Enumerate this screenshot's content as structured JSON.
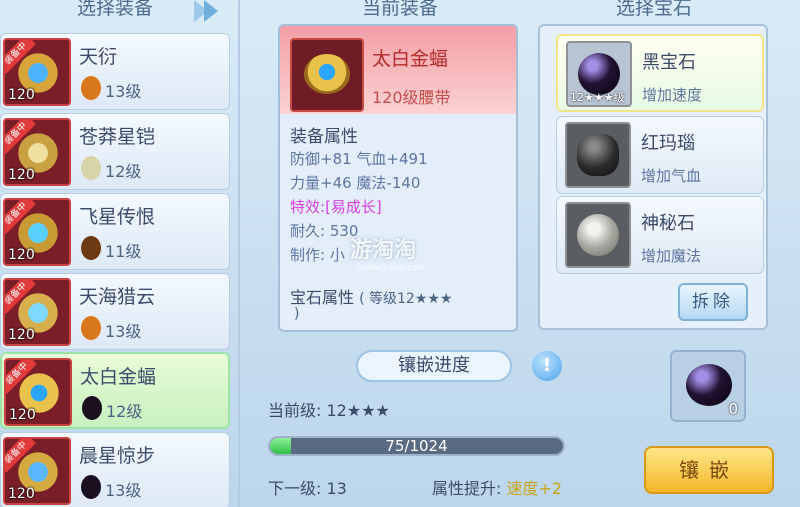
{
  "headers": {
    "select_equipment": "选择装备",
    "current_equipment": "当前装备",
    "select_gem": "选择宝石"
  },
  "equipment_list": [
    {
      "badge": "装备中",
      "level": "120",
      "name": "天衍",
      "gem_level": "13级",
      "gem_color": "#d9771b"
    },
    {
      "badge": "装备中",
      "level": "120",
      "name": "苍莽星铠",
      "gem_level": "12级",
      "gem_color": "#d8d3a8"
    },
    {
      "badge": "装备中",
      "level": "120",
      "name": "飞星传恨",
      "gem_level": "11级",
      "gem_color": "#6b3a12"
    },
    {
      "badge": "装备中",
      "level": "120",
      "name": "天海猎云",
      "gem_level": "13级",
      "gem_color": "#d9771b"
    },
    {
      "badge": "装备中",
      "level": "120",
      "name": "太白金蝠",
      "gem_level": "12级",
      "gem_color": "#1a1020"
    },
    {
      "badge": "装备中",
      "level": "120",
      "name": "晨星惊步",
      "gem_level": "13级",
      "gem_color": "#1a1020"
    }
  ],
  "current": {
    "name": "太白金蝠",
    "type": "120级腰带",
    "attr_title": "装备属性",
    "lines": [
      "防御+81 气血+491",
      "力量+46 魔法-140"
    ],
    "special_label": "特效:",
    "special_value": "[易成长]",
    "durability": "耐久: 530",
    "maker": "制作: 小",
    "gem_attr_label": "宝石属性",
    "gem_attr_value": "( 等级12★★★",
    "gem_attr_cont": ")"
  },
  "watermark": {
    "main": "游淘淘",
    "sub": "toutaoyouxi.com"
  },
  "progress": {
    "tag": "镶嵌进度",
    "help": "!",
    "current_level_label": "当前级:",
    "current_level": "12★★★",
    "bar_text": "75/1024",
    "fraction": 0.073,
    "next_level_label": "下一级:",
    "next_level": "13",
    "attr_up_label": "属性提升:",
    "attr_up_value": "速度+2"
  },
  "gems": [
    {
      "name": "黑宝石",
      "desc": "增加速度",
      "level": "12★★★级",
      "selected": true,
      "color": "#140a22"
    },
    {
      "name": "红玛瑙",
      "desc": "增加气血",
      "level": "",
      "selected": false,
      "color": "#2b2b2b"
    },
    {
      "name": "神秘石",
      "desc": "增加魔法",
      "level": "",
      "selected": false,
      "color": "#8a8a84"
    }
  ],
  "buttons": {
    "remove": "拆除",
    "inlay": "镶嵌"
  },
  "slot": {
    "count": "0"
  }
}
